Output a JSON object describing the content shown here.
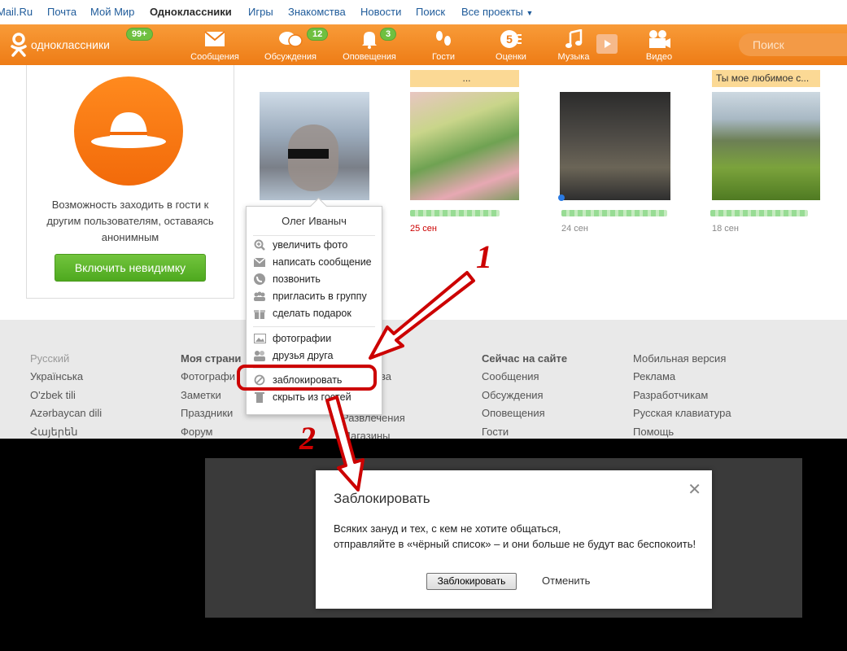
{
  "portal": {
    "links": [
      "Mail.Ru",
      "Почта",
      "Мой Мир",
      "Одноклассники",
      "Игры",
      "Знакомства",
      "Новости",
      "Поиск",
      "Все проекты"
    ]
  },
  "toolbar": {
    "logo_text": "одноклассники",
    "logo_badge": "99+",
    "nav": [
      {
        "label": "Сообщения",
        "icon": "envelope-icon"
      },
      {
        "label": "Обсуждения",
        "icon": "chat-bubbles-icon",
        "badge": "12"
      },
      {
        "label": "Оповещения",
        "icon": "bell-icon",
        "badge": "3"
      },
      {
        "label": "Гости",
        "icon": "footprints-icon"
      },
      {
        "label": "Оценки",
        "icon": "rating-icon"
      },
      {
        "label": "Музыка",
        "icon": "music-note-icon"
      },
      {
        "label": "Видео",
        "icon": "video-camera-icon"
      }
    ],
    "search_placeholder": "Поиск"
  },
  "invisible_card": {
    "text": "Возможность заходить в гости к другим пользователям, оставаясь анонимным",
    "button": "Включить невидимку"
  },
  "photos": [
    {
      "caption": "",
      "date": ""
    },
    {
      "caption": "...",
      "date": "25 сен",
      "date_color": "#cc0000"
    },
    {
      "caption": "",
      "date": "24 сен"
    },
    {
      "caption": "Ты мое любимое с...",
      "date": "18 сен"
    }
  ],
  "context_menu": {
    "name": "Олег Иваныч",
    "items": [
      {
        "label": "увеличить фото",
        "icon": "zoom-in-icon"
      },
      {
        "label": "написать сообщение",
        "icon": "envelope-icon"
      },
      {
        "label": "позвонить",
        "icon": "phone-icon"
      },
      {
        "label": "пригласить в группу",
        "icon": "group-icon"
      },
      {
        "label": "сделать подарок",
        "icon": "gift-icon"
      },
      {
        "label": "фотографии",
        "icon": "photo-icon"
      },
      {
        "label": "друзья друга",
        "icon": "friends-icon"
      },
      {
        "label": "заблокировать",
        "icon": "block-icon"
      },
      {
        "label": "скрыть из гостей",
        "icon": "trash-icon"
      }
    ]
  },
  "footer": {
    "languages": [
      "Русский",
      "Українська",
      "O'zbek tili",
      "Azərbaycan dili",
      "Հայերեն"
    ],
    "col2_title": "Моя страни",
    "col2_items": [
      "Фотографи",
      "Заметки",
      "Праздники",
      "Форум"
    ],
    "col3_items": [
      "ва",
      "Развлечения",
      "Магазины"
    ],
    "col4_title": "Сейчас на сайте",
    "col4_items": [
      "Сообщения",
      "Обсуждения",
      "Оповещения",
      "Гости"
    ],
    "col5_items": [
      "Мобильная версия",
      "Реклама",
      "Разработчикам",
      "Русская клавиатура",
      "Помощь"
    ]
  },
  "dialog": {
    "title": "Заблокировать",
    "line1": "Всяких зануд и тех, с кем не хотите общаться,",
    "line2": "отправляйте в «чёрный список» – и они больше не будут вас беспокоить!",
    "confirm": "Заблокировать",
    "cancel": "Отменить",
    "close_glyph": "✕"
  },
  "annotations": {
    "step1": "1",
    "step2": "2",
    "highlight_color": "#cc0000"
  },
  "colors": {
    "toolbar_orange": "#ee7c16",
    "badge_green": "#6fc040",
    "button_green": "#4ea91f",
    "link_blue": "#1f5b9a"
  }
}
